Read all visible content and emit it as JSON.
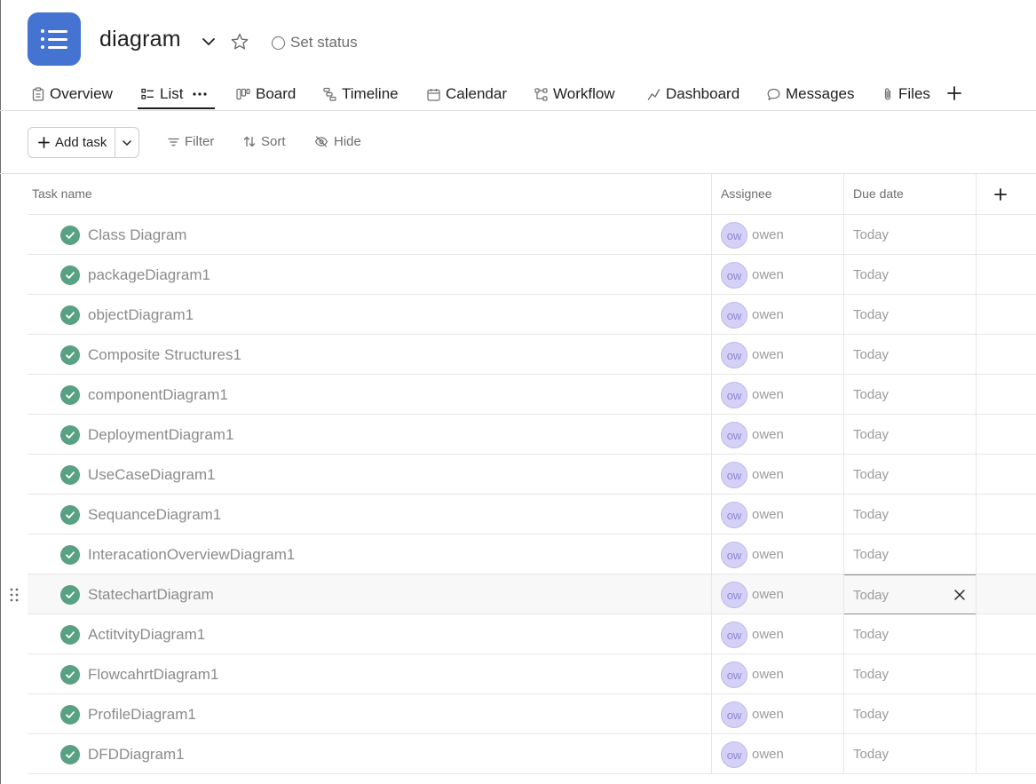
{
  "project": {
    "title": "diagram",
    "status_label": "Set status",
    "accent": "#4573d2"
  },
  "tabs": [
    {
      "label": "Overview",
      "icon": "clipboard-icon"
    },
    {
      "label": "List",
      "icon": "list-icon",
      "active": true
    },
    {
      "label": "Board",
      "icon": "board-icon"
    },
    {
      "label": "Timeline",
      "icon": "timeline-icon"
    },
    {
      "label": "Calendar",
      "icon": "calendar-icon"
    },
    {
      "label": "Workflow",
      "icon": "workflow-icon"
    },
    {
      "label": "Dashboard",
      "icon": "dashboard-icon"
    },
    {
      "label": "Messages",
      "icon": "message-icon"
    },
    {
      "label": "Files",
      "icon": "paperclip-icon"
    }
  ],
  "toolbar": {
    "add_task": "Add task",
    "filter": "Filter",
    "sort": "Sort",
    "hide": "Hide"
  },
  "table": {
    "columns": [
      "Task name",
      "Assignee",
      "Due date"
    ],
    "rows": [
      {
        "name": "Class Diagram",
        "assignee_initials": "ow",
        "assignee": "owen",
        "due": "Today"
      },
      {
        "name": "packageDiagram1",
        "assignee_initials": "ow",
        "assignee": "owen",
        "due": "Today"
      },
      {
        "name": "objectDiagram1",
        "assignee_initials": "ow",
        "assignee": "owen",
        "due": "Today"
      },
      {
        "name": "Composite Structures1",
        "assignee_initials": "ow",
        "assignee": "owen",
        "due": "Today"
      },
      {
        "name": "componentDiagram1",
        "assignee_initials": "ow",
        "assignee": "owen",
        "due": "Today"
      },
      {
        "name": "DeploymentDiagram1",
        "assignee_initials": "ow",
        "assignee": "owen",
        "due": "Today"
      },
      {
        "name": "UseCaseDiagram1",
        "assignee_initials": "ow",
        "assignee": "owen",
        "due": "Today"
      },
      {
        "name": "SequanceDiagram1",
        "assignee_initials": "ow",
        "assignee": "owen",
        "due": "Today"
      },
      {
        "name": "InteracationOverviewDiagram1",
        "assignee_initials": "ow",
        "assignee": "owen",
        "due": "Today"
      },
      {
        "name": "StatechartDiagram",
        "assignee_initials": "ow",
        "assignee": "owen",
        "due": "Today"
      },
      {
        "name": "ActitvityDiagram1",
        "assignee_initials": "ow",
        "assignee": "owen",
        "due": "Today"
      },
      {
        "name": "FlowcahrtDiagram1",
        "assignee_initials": "ow",
        "assignee": "owen",
        "due": "Today"
      },
      {
        "name": "ProfileDiagram1",
        "assignee_initials": "ow",
        "assignee": "owen",
        "due": "Today"
      },
      {
        "name": "DFDDiagram1",
        "assignee_initials": "ow",
        "assignee": "owen",
        "due": "Today"
      }
    ]
  },
  "colors": {
    "complete_check": "#58a182",
    "avatar_bg": "#d5d1f6"
  }
}
